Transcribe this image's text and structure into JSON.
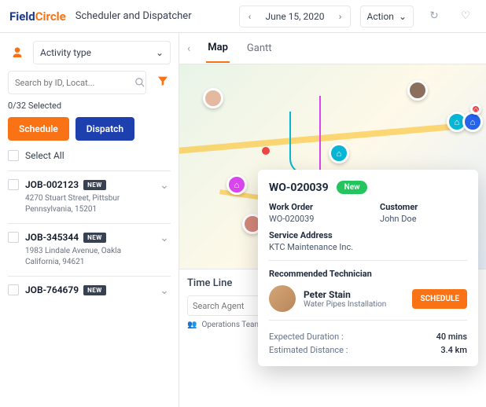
{
  "header": {
    "logo_field": "Field",
    "logo_circle": "Circle",
    "title": "Scheduler and Dispatcher",
    "date": "June 15, 2020",
    "action_label": "Action"
  },
  "sidebar": {
    "activity_label": "Activity type",
    "search_placeholder": "Search by ID, Locat...",
    "selected_text": "0/32 Selected",
    "schedule_btn": "Schedule",
    "dispatch_btn": "Dispatch",
    "select_all": "Select All",
    "new_badge": "NEW",
    "jobs": [
      {
        "id": "JOB-002123",
        "addr": "4270 Stuart Street, Pittsbur Pennsylvania, 15201"
      },
      {
        "id": "JOB-345344",
        "addr": "1983 Lindale Avenue, Oakla California, 94621"
      },
      {
        "id": "JOB-764679",
        "addr": ""
      }
    ]
  },
  "tabs": {
    "map": "Map",
    "gantt": "Gantt"
  },
  "timeline": {
    "title": "Time Line",
    "agent_placeholder": "Search Agent",
    "ops": "Operations Team"
  },
  "popup": {
    "wo_id": "WO-020039",
    "status": "New",
    "wo_label": "Work Order",
    "wo_val": "WO-020039",
    "cust_label": "Customer",
    "cust_val": "John Doe",
    "addr_label": "Service Address",
    "addr_val": "KTC Maintenance Inc.",
    "rec_label": "Recommended Technician",
    "tech_name": "Peter Stain",
    "tech_role": "Water Pipes Installation",
    "sched_btn": "SCHEDULE",
    "dur_label": "Expected Duration :",
    "dur_val": "40 mins",
    "dist_label": "Estimated Distance :",
    "dist_val": "3.4 km"
  }
}
